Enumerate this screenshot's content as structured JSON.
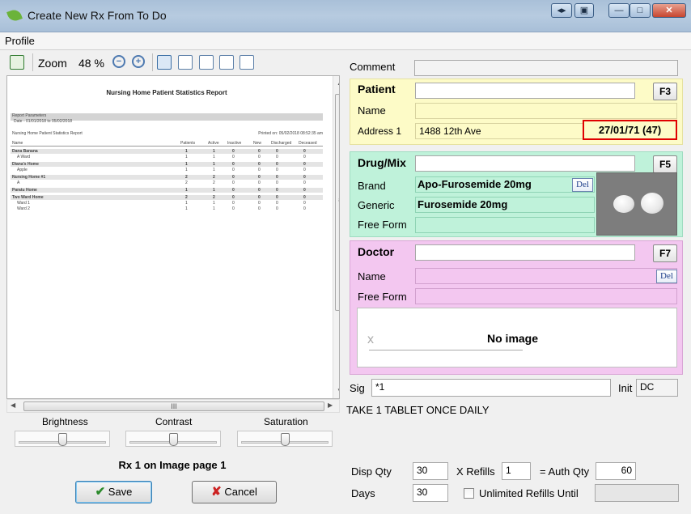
{
  "window": {
    "title": "Create New Rx From To Do"
  },
  "menu": {
    "profile": "Profile"
  },
  "toolbar": {
    "zoom_label": "Zoom",
    "zoom_value": "48 %"
  },
  "report": {
    "title": "Nursing Home Patient Statistics Report",
    "params_heading": "Report Parameters",
    "params_dates": "Date - 01/01/2018 to 05/02/2018",
    "subtitle": "Nursing Home Patient Statistics Report",
    "printed": "Printed on: 05/02/2018 08:52:35 am",
    "columns": [
      "Name",
      "Patients",
      "Active",
      "Inactive",
      "New",
      "Discharged",
      "Deceased"
    ],
    "rows": [
      {
        "name": "Dana Banana",
        "vals": [
          "1",
          "1",
          "0",
          "0",
          "0",
          "0"
        ],
        "group": true
      },
      {
        "name": "A Ward",
        "vals": [
          "1",
          "1",
          "0",
          "0",
          "0",
          "0"
        ],
        "group": false
      },
      {
        "name": "Diana's Home",
        "vals": [
          "1",
          "1",
          "0",
          "0",
          "0",
          "0"
        ],
        "group": true
      },
      {
        "name": "Apple",
        "vals": [
          "1",
          "1",
          "0",
          "0",
          "0",
          "0"
        ],
        "group": false
      },
      {
        "name": "Nursing Home #1",
        "vals": [
          "2",
          "2",
          "0",
          "0",
          "0",
          "0"
        ],
        "group": true
      },
      {
        "name": "A",
        "vals": [
          "2",
          "2",
          "0",
          "0",
          "0",
          "0"
        ],
        "group": false
      },
      {
        "name": "Paratu Home",
        "vals": [
          "1",
          "1",
          "0",
          "0",
          "0",
          "0"
        ],
        "group": true
      },
      {
        "name": "Two Ward Home",
        "vals": [
          "2",
          "2",
          "0",
          "0",
          "0",
          "0"
        ],
        "group": true
      },
      {
        "name": "Ward 1",
        "vals": [
          "1",
          "1",
          "0",
          "0",
          "0",
          "0"
        ],
        "group": false
      },
      {
        "name": "Ward 2",
        "vals": [
          "1",
          "1",
          "0",
          "0",
          "0",
          "0"
        ],
        "group": false
      }
    ]
  },
  "sliders": {
    "brightness": "Brightness",
    "contrast": "Contrast",
    "saturation": "Saturation"
  },
  "image_page": "Rx 1 on Image page 1",
  "buttons": {
    "save": "Save",
    "cancel": "Cancel"
  },
  "comment": {
    "label": "Comment",
    "value": ""
  },
  "patient": {
    "heading": "Patient",
    "fkey": "F3",
    "name_label": "Name",
    "address_label": "Address 1",
    "address_value": "1488 12th Ave",
    "dob": "27/01/71 (47)"
  },
  "drug": {
    "heading": "Drug/Mix",
    "fkey": "F5",
    "brand_label": "Brand",
    "brand_value": "Apo-Furosemide 20mg",
    "generic_label": "Generic",
    "generic_value": "Furosemide 20mg",
    "free_form_label": "Free Form",
    "del": "Del"
  },
  "doctor": {
    "heading": "Doctor",
    "fkey": "F7",
    "name_label": "Name",
    "free_form_label": "Free Form",
    "del": "Del",
    "no_image": "No image",
    "x_mark": "x"
  },
  "sig": {
    "label": "Sig",
    "value": "*1",
    "init_label": "Init",
    "init_value": "DC"
  },
  "directions": "TAKE 1 TABLET ONCE DAILY",
  "quantity": {
    "disp_label": "Disp Qty",
    "disp_value": "30",
    "refills_label": "X Refills",
    "refills_value": "1",
    "auth_label": "= Auth Qty",
    "auth_value": "60",
    "days_label": "Days",
    "days_value": "30",
    "unlimited_label": "Unlimited Refills Until"
  }
}
